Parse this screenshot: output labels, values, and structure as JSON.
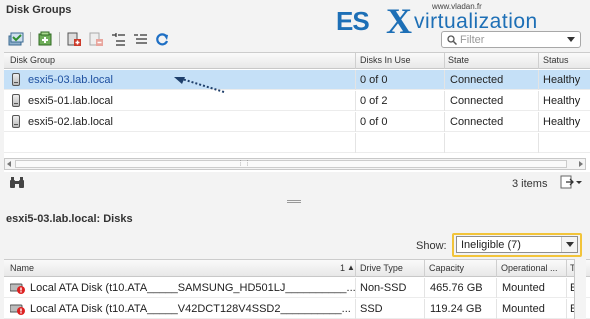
{
  "disk_groups_panel": {
    "title": "Disk Groups",
    "filter": {
      "placeholder": "Filter"
    },
    "toolbar": {
      "icons": [
        "claim-disks-icon",
        "create-disk-group-icon",
        "add-disk-icon",
        "remove-disk-icon",
        "expand-all-icon",
        "collapse-all-icon",
        "refresh-icon"
      ]
    },
    "columns": [
      "Disk Group",
      "Disks In Use",
      "State",
      "Status"
    ],
    "rows": [
      {
        "disk_group": "esxi5-03.lab.local",
        "disks_in_use": "0 of 0",
        "state": "Connected",
        "status": "Healthy",
        "selected": true
      },
      {
        "disk_group": "esxi5-01.lab.local",
        "disks_in_use": "0 of 2",
        "state": "Connected",
        "status": "Healthy",
        "selected": false
      },
      {
        "disk_group": "esxi5-02.lab.local",
        "disks_in_use": "0 of 0",
        "state": "Connected",
        "status": "Healthy",
        "selected": false
      }
    ],
    "footer": {
      "items_count": "3 items"
    }
  },
  "watermark": {
    "small": "www.vladan.fr",
    "brand_es": "ES",
    "brand_x": "X",
    "brand_rest": "virtualization"
  },
  "disks_panel": {
    "title": "esxi5-03.lab.local: Disks",
    "show_label": "Show:",
    "show_value": "Ineligible (7)",
    "columns": {
      "name": "Name",
      "sort_index": "1",
      "drive_type": "Drive Type",
      "capacity": "Capacity",
      "operational": "Operational ...",
      "last": "T"
    },
    "rows": [
      {
        "name": "Local ATA Disk (t10.ATA_____SAMSUNG_HD501LJ__________...",
        "drive_type": "Non-SSD",
        "capacity": "465.76 GB",
        "operational": "Mounted",
        "last": "E"
      },
      {
        "name": "Local ATA Disk (t10.ATA_____V42DCT128V4SSD2__________...",
        "drive_type": "SSD",
        "capacity": "119.24 GB",
        "operational": "Mounted",
        "last": "E"
      }
    ]
  },
  "colors": {
    "selected_row": "#c5e0f7",
    "highlight_box": "#f2c43a",
    "brand_blue": "#1d6fb6"
  }
}
